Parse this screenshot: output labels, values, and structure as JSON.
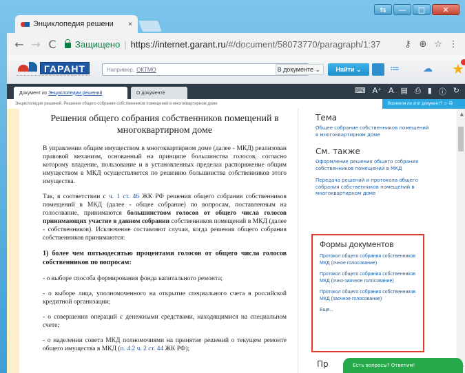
{
  "window": {
    "controls": {
      "extra": "⇆",
      "minimize": "—",
      "maximize": "□",
      "close": "✕"
    }
  },
  "tab": {
    "title": "Энциклопедия решени",
    "close": "×"
  },
  "toolbar": {
    "back": "←",
    "forward": "→",
    "reload": "C",
    "secure_label": "Защищено",
    "separator": "|",
    "url_host": "https://internet.garant.ru",
    "url_rest": "/#/document/58073770/paragraph/1:37",
    "key_icon": "⚷",
    "zoom_icon": "⊕",
    "bookmark_icon": "☆",
    "menu_icon": "⋮"
  },
  "garant": {
    "logo_text": "ГАРАНТ",
    "search_placeholder": "Например,",
    "search_placeholder_link": "ОКТМО",
    "scope_label": "В документе ⌄",
    "find_button": "Найти ⌄",
    "icons": {
      "filter": "≔",
      "chat": "☁",
      "star": "★"
    }
  },
  "doc_tabs": {
    "active_prefix": "Документ из",
    "active_link": "Энциклопедии решений",
    "other": "О документе",
    "icons": [
      "⌨",
      "A⁺",
      "A",
      "▤",
      "⎙",
      "▮",
      "ⓘ",
      "↻"
    ]
  },
  "breadcrumb": {
    "text": "Энциклопедия решений. Решения общего собрания собственников помещений в многоквартирном доме",
    "help": "Возникли ли этот документ?  ☺ ☹"
  },
  "document": {
    "title": "Решения общего собрания собственников помещений в многоквартирном доме",
    "p1": "В управлении общим имуществом в многоквартирном доме (далее - МКД) реализован правовой механизм, основанный на принципе большинства голосов, согласно которому владение, пользование и в установленных пределах распоряжение общим имуществом в МКД осуществляется по решению большинства собственников этого имущества.",
    "p2_a": "Так, в соответствии с",
    "p2_link": "ч. 1 ст. 46",
    "p2_b": "ЖК РФ решения общего собрания собственников помещений в МКД (далее - общее собрание) по вопросам, поставленным на голосование, принимаются",
    "p2_bold": "большинством голосов от общего числа голосов принимающих участие в данном собрании",
    "p2_c": "собственников помещений в МКД (далее - собственников). Исключение составляют случаи, когда решения общего собрания собственников принимаются:",
    "p3": "1) более чем пятьюдесятью процентами голосов от общего числа голосов собственников по вопросам:",
    "p4": "- о выборе способа формирования фонда капитального ремонта;",
    "p5": "- о выборе лица, уполномоченного на открытие специального счета в российской кредитной организации;",
    "p6": "- о совершении операций с денежными средствами, находящимися на специальном счете;",
    "p7_a": "- о наделении совета МКД полномочиями на принятие решений о текущем ремонте общего имущества в МКД (",
    "p7_link": "п. 4.2 ч. 2 ст. 44",
    "p7_b": " ЖК РФ);"
  },
  "sidebar": {
    "topic_title": "Тема",
    "topic_link": "Общее собрание собственников помещений в многоквартирном доме",
    "see_also_title": "См. также",
    "see_also_1": "Оформление решения общего собрания собственников помещений в МКД",
    "see_also_2": "Передача решений и протокола общего собрания собственников помещений в многоквартирном доме",
    "forms_title": "Формы документов",
    "form_1": "Протокол общего собрания собственников МКД (очное голосование)",
    "form_2": "Протокол общего собрания собственников МКД (очно-заочное голосование)",
    "form_3": "Протокол общего собрания собственников МКД (заочное голосование)",
    "more": "Еще...",
    "next_title": "Пр"
  },
  "chat_widget": {
    "label": "Есть вопросы? Ответим!"
  },
  "colors": {
    "accent": "#1b5fa6",
    "highlight": "#e0382a",
    "chat": "#27a84a",
    "secure": "#0b8043"
  }
}
